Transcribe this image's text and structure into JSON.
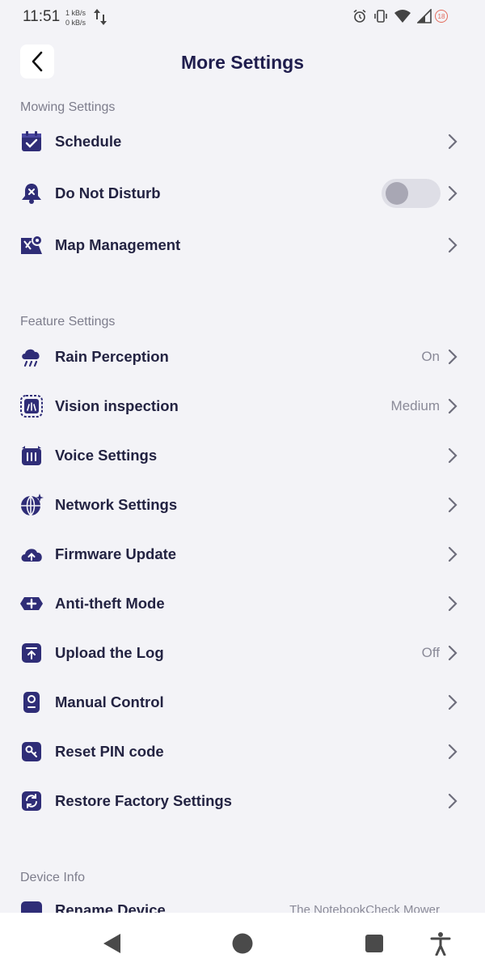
{
  "status_bar": {
    "time": "11:51",
    "net_up": "1 kB/s",
    "net_down": "0 kB/s",
    "battery_badge": "18",
    "icons": [
      "alarm-icon",
      "vibrate-icon",
      "wifi-icon",
      "signal-icon",
      "battery-icon"
    ]
  },
  "header": {
    "title": "More Settings",
    "back_icon": "back-arrow-icon"
  },
  "sections": {
    "mowing": "Mowing Settings",
    "feature": "Feature Settings",
    "device": "Device Info"
  },
  "rows": {
    "schedule": {
      "label": "Schedule",
      "icon": "calendar-check-icon"
    },
    "dnd": {
      "label": "Do Not Disturb",
      "icon": "bell-off-icon",
      "toggle_on": false
    },
    "map": {
      "label": "Map Management",
      "icon": "map-pin-icon"
    },
    "rain": {
      "label": "Rain Perception",
      "value": "On",
      "icon": "rain-cloud-icon"
    },
    "vision": {
      "label": "Vision inspection",
      "value": "Medium",
      "icon": "vision-scan-icon"
    },
    "voice": {
      "label": "Voice Settings",
      "icon": "voice-icon"
    },
    "network": {
      "label": "Network Settings",
      "icon": "globe-icon"
    },
    "firmware": {
      "label": "Firmware Update",
      "icon": "cloud-upload-icon"
    },
    "antitheft": {
      "label": "Anti-theft Mode",
      "icon": "shield-plus-icon"
    },
    "upload_log": {
      "label": "Upload the Log",
      "value": "Off",
      "icon": "upload-icon"
    },
    "manual": {
      "label": "Manual Control",
      "icon": "remote-control-icon"
    },
    "reset_pin": {
      "label": "Reset PIN code",
      "icon": "key-icon"
    },
    "restore": {
      "label": "Restore Factory Settings",
      "icon": "refresh-icon"
    },
    "rename": {
      "label": "Rename Device",
      "value": "The NotebookCheck Mower",
      "icon": "pencil-icon"
    }
  },
  "colors": {
    "accent": "#2f2d77",
    "background": "#f3f3f7",
    "text": "#232342",
    "muted": "#8a8a98"
  },
  "nav": {
    "icons": [
      "back-triangle-icon",
      "home-circle-icon",
      "recents-square-icon",
      "accessibility-icon"
    ]
  }
}
